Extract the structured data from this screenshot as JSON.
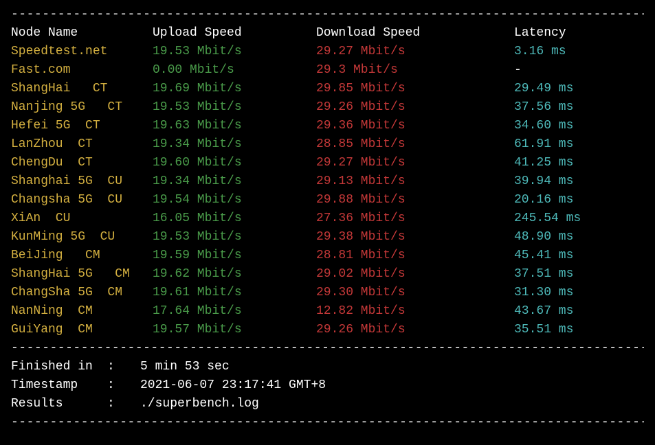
{
  "divider": "----------------------------------------------------------------------------------",
  "headers": {
    "node": "Node Name",
    "upload": "Upload Speed",
    "download": "Download Speed",
    "latency": "Latency"
  },
  "rows": [
    {
      "node": "Speedtest.net",
      "upload": "19.53 Mbit/s",
      "download": "29.27 Mbit/s",
      "latency": "3.16 ms"
    },
    {
      "node": "Fast.com",
      "upload": "0.00 Mbit/s",
      "download": "29.3 Mbit/s",
      "latency": "-"
    },
    {
      "node": "ShangHai   CT",
      "upload": "19.69 Mbit/s",
      "download": "29.85 Mbit/s",
      "latency": "29.49 ms"
    },
    {
      "node": "Nanjing 5G   CT",
      "upload": "19.53 Mbit/s",
      "download": "29.26 Mbit/s",
      "latency": "37.56 ms"
    },
    {
      "node": "Hefei 5G  CT",
      "upload": "19.63 Mbit/s",
      "download": "29.36 Mbit/s",
      "latency": "34.60 ms"
    },
    {
      "node": "LanZhou  CT",
      "upload": "19.34 Mbit/s",
      "download": "28.85 Mbit/s",
      "latency": "61.91 ms"
    },
    {
      "node": "ChengDu  CT",
      "upload": "19.60 Mbit/s",
      "download": "29.27 Mbit/s",
      "latency": "41.25 ms"
    },
    {
      "node": "Shanghai 5G  CU",
      "upload": "19.34 Mbit/s",
      "download": "29.13 Mbit/s",
      "latency": "39.94 ms"
    },
    {
      "node": "Changsha 5G  CU",
      "upload": "19.54 Mbit/s",
      "download": "29.88 Mbit/s",
      "latency": "20.16 ms"
    },
    {
      "node": "XiAn  CU",
      "upload": "16.05 Mbit/s",
      "download": "27.36 Mbit/s",
      "latency": "245.54 ms"
    },
    {
      "node": "KunMing 5G  CU",
      "upload": "19.53 Mbit/s",
      "download": "29.38 Mbit/s",
      "latency": "48.90 ms"
    },
    {
      "node": "BeiJing   CM",
      "upload": "19.59 Mbit/s",
      "download": "28.81 Mbit/s",
      "latency": "45.41 ms"
    },
    {
      "node": "ShangHai 5G   CM",
      "upload": "19.62 Mbit/s",
      "download": "29.02 Mbit/s",
      "latency": "37.51 ms"
    },
    {
      "node": "ChangSha 5G  CM",
      "upload": "19.61 Mbit/s",
      "download": "29.30 Mbit/s",
      "latency": "31.30 ms"
    },
    {
      "node": "NanNing  CM",
      "upload": "17.64 Mbit/s",
      "download": "12.82 Mbit/s",
      "latency": "43.67 ms"
    },
    {
      "node": "GuiYang  CM",
      "upload": "19.57 Mbit/s",
      "download": "29.26 Mbit/s",
      "latency": "35.51 ms"
    }
  ],
  "footer": {
    "finished_label": "Finished in",
    "finished_value": "5 min 53 sec",
    "timestamp_label": "Timestamp",
    "timestamp_value": "2021-06-07 23:17:41 GMT+8",
    "results_label": "Results",
    "results_value": "./superbench.log",
    "separator": ": "
  }
}
